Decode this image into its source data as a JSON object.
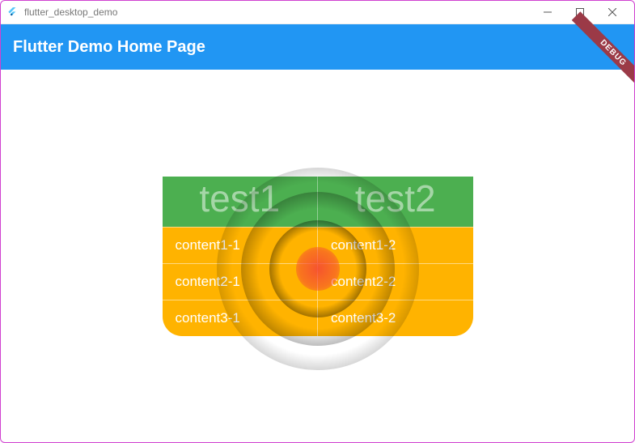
{
  "window": {
    "title": "flutter_desktop_demo"
  },
  "appbar": {
    "title": "Flutter Demo Home Page"
  },
  "debug_banner": {
    "label": "DEBUG"
  },
  "table": {
    "headers": [
      "test1",
      "test2"
    ],
    "rows": [
      [
        "content1-1",
        "content1-2"
      ],
      [
        "content2-1",
        "content2-2"
      ],
      [
        "content3-1",
        "content3-2"
      ]
    ]
  }
}
